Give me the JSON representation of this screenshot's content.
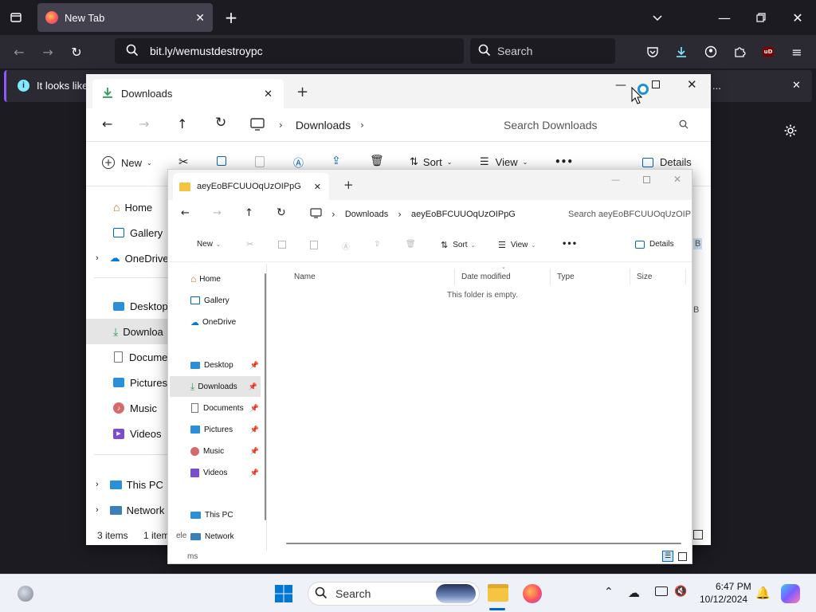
{
  "firefox": {
    "tab_title": "New Tab",
    "url": "bit.ly/wemustdestroypc",
    "search_placeholder": "Search",
    "notice_text": "It looks like",
    "notice_more": "...",
    "addon_badge": "uD"
  },
  "explorer_back": {
    "tab_title": "Downloads",
    "breadcrumb": "Downloads",
    "search_placeholder": "Search Downloads",
    "toolbar": {
      "new_label": "New",
      "sort_label": "Sort",
      "view_label": "View",
      "more_label": "•••",
      "details_label": "Details"
    },
    "nav": {
      "home": "Home",
      "gallery": "Gallery",
      "onedrive": "OneDrive",
      "desktop": "Desktop",
      "downloads": "Downloa",
      "documents": "Docume",
      "pictures": "Pictures",
      "music": "Music",
      "videos": "Videos",
      "thispc": "This PC",
      "network": "Network"
    },
    "status_items": "3 items",
    "status_selected": "1 item",
    "size_partial_1": "B",
    "size_partial_2": "B"
  },
  "explorer_front": {
    "tab_title": "aeyEoBFCUUOqUzOIPpG",
    "breadcrumb": [
      "Downloads",
      "aeyEoBFCUUOqUzOIPpG"
    ],
    "search_placeholder": "Search aeyEoBFCUUOqUzOIPpG",
    "toolbar": {
      "new_label": "New",
      "sort_label": "Sort",
      "view_label": "View",
      "more_label": "•••",
      "details_label": "Details"
    },
    "nav": {
      "home": "Home",
      "gallery": "Gallery",
      "onedrive": "OneDrive",
      "desktop": "Desktop",
      "downloads": "Downloads",
      "documents": "Documents",
      "pictures": "Pictures",
      "music": "Music",
      "videos": "Videos",
      "thispc": "This PC",
      "network": "Network"
    },
    "columns": {
      "name": "Name",
      "date": "Date modified",
      "type": "Type",
      "size": "Size"
    },
    "empty_message": "This folder is empty.",
    "status_partial_left": "ele",
    "status_partial_bottom": "ms"
  },
  "taskbar": {
    "search_label": "Search",
    "time": "6:47 PM",
    "date": "10/12/2024"
  },
  "colors": {
    "firefox_bg": "#1c1b22",
    "firefox_accent": "#9059ff",
    "explorer_accent": "#0067c0",
    "download_green": "#2e9a5a",
    "folder_yellow": "#f5c542"
  }
}
